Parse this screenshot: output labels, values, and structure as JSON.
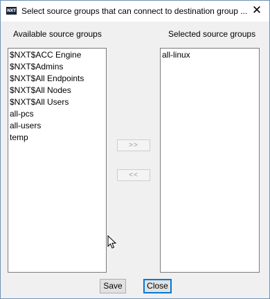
{
  "window": {
    "title": "Select source groups that can connect to destination group ...",
    "app_icon_text": "NXT",
    "close_glyph": "✕"
  },
  "available": {
    "label": "Available source groups",
    "items": [
      "$NXT$ACC Engine",
      "$NXT$Admins",
      "$NXT$All Endpoints",
      "$NXT$All Nodes",
      "$NXT$All Users",
      "all-pcs",
      "all-users",
      "temp"
    ]
  },
  "selected": {
    "label": "Selected source groups",
    "items": [
      "all-linux"
    ]
  },
  "controls": {
    "add_label": ">>",
    "remove_label": "<<",
    "save_label": "Save",
    "close_label": "Close"
  },
  "icons": {
    "app": "nxt-app-icon",
    "close": "close-icon",
    "cursor": "mouse-pointer-icon"
  }
}
